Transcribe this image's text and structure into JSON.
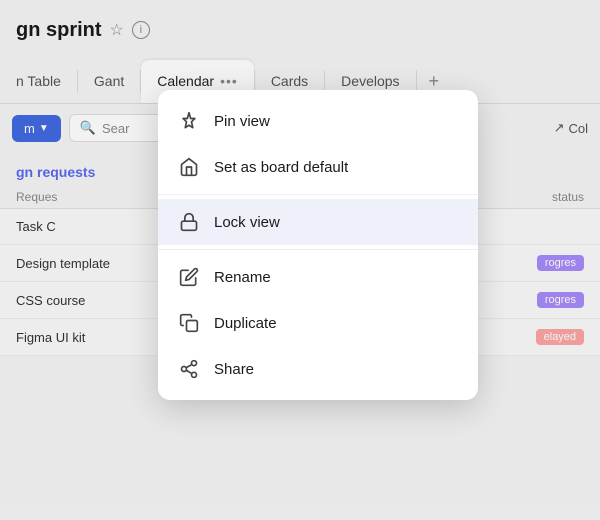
{
  "header": {
    "title": "gn sprint",
    "star_icon": "★",
    "info_icon": "ⓘ"
  },
  "tabs": {
    "items": [
      {
        "label": "n Table",
        "active": false
      },
      {
        "label": "Gant",
        "active": false
      },
      {
        "label": "Calendar",
        "active": true
      },
      {
        "label": "Cards",
        "active": false
      },
      {
        "label": "Develops",
        "active": false
      }
    ],
    "plus_label": "+",
    "dots_label": "···"
  },
  "toolbar": {
    "primary_button": "m",
    "search_placeholder": "Sear",
    "col_label": "Col"
  },
  "content": {
    "section_title": "gn requests",
    "table_header": "Reques",
    "status_header": "status",
    "rows": [
      {
        "name": "Task C",
        "status": null
      },
      {
        "name": "Design template",
        "status": "progress",
        "status_label": "rogres"
      },
      {
        "name": "CSS course",
        "status": "progress",
        "status_label": "rogres"
      },
      {
        "name": "Figma UI kit",
        "status": "delayed",
        "status_label": "elayed"
      }
    ]
  },
  "dropdown": {
    "items": [
      {
        "id": "pin",
        "label": "Pin view",
        "icon": "pin"
      },
      {
        "id": "board-default",
        "label": "Set as board default",
        "icon": "home"
      },
      {
        "id": "lock",
        "label": "Lock view",
        "icon": "lock",
        "active": true
      },
      {
        "id": "rename",
        "label": "Rename",
        "icon": "pencil"
      },
      {
        "id": "duplicate",
        "label": "Duplicate",
        "icon": "copy"
      },
      {
        "id": "share",
        "label": "Share",
        "icon": "share"
      }
    ]
  }
}
